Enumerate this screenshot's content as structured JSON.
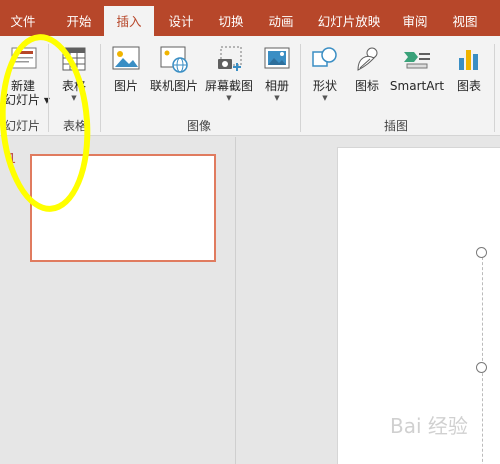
{
  "tabs": [
    "文件",
    "开始",
    "插入",
    "设计",
    "切换",
    "动画",
    "幻灯片放映",
    "审阅",
    "视图"
  ],
  "active_tab": "插入",
  "ribbon": {
    "new_slide": {
      "line1": "新建",
      "line2": "幻灯片"
    },
    "table": "表格",
    "picture": "图片",
    "online_picture": "联机图片",
    "screenshot": "屏幕截图",
    "album": "相册",
    "shapes": "形状",
    "icons": "图标",
    "smartart": "SmartArt",
    "chart": "图表"
  },
  "groups": {
    "slides": "幻灯片",
    "tables": "表格",
    "images": "图像",
    "illustrations": "插图"
  },
  "thumbnail": {
    "number": "1"
  },
  "watermark": "Bai 经验",
  "colors": {
    "accent": "#b7472a",
    "highlight": "#ffff00"
  }
}
